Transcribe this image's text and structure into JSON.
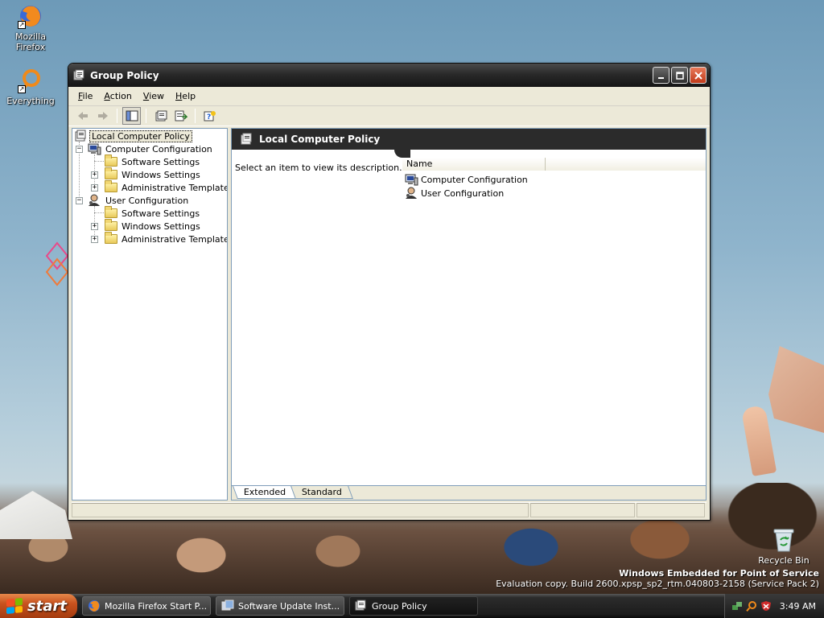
{
  "desktop": {
    "icons": [
      {
        "label": "Mozilla Firefox"
      },
      {
        "label": "Everything"
      }
    ],
    "recycle_bin": {
      "label": "Recycle Bin"
    },
    "watermark": {
      "line1": "Windows Embedded for Point of Service",
      "line2": "Evaluation copy. Build 2600.xpsp_sp2_rtm.040803-2158 (Service Pack 2)"
    }
  },
  "window": {
    "title": "Group Policy",
    "menu": [
      {
        "label": "File",
        "accel": "F",
        "rest": "ile"
      },
      {
        "label": "Action",
        "accel": "A",
        "rest": "ction"
      },
      {
        "label": "View",
        "accel": "V",
        "rest": "iew"
      },
      {
        "label": "Help",
        "accel": "H",
        "rest": "elp"
      }
    ],
    "tree": {
      "root": "Local Computer Policy",
      "computer": {
        "label": "Computer Configuration",
        "children": [
          "Software Settings",
          "Windows Settings",
          "Administrative Templates"
        ]
      },
      "user": {
        "label": "User Configuration",
        "children": [
          "Software Settings",
          "Windows Settings",
          "Administrative Templates"
        ]
      }
    },
    "right_pane": {
      "header_title": "Local Computer Policy",
      "description": "Select an item to view its description.",
      "columns": [
        "Name"
      ],
      "items": [
        "Computer Configuration",
        "User Configuration"
      ],
      "tabs": [
        "Extended",
        "Standard"
      ]
    }
  },
  "taskbar": {
    "start_label": "start",
    "tasks": [
      {
        "label": "Mozilla Firefox Start P..."
      },
      {
        "label": "Software Update Inst..."
      },
      {
        "label": "Group Policy"
      }
    ],
    "clock": "3:49 AM"
  },
  "colors": {
    "title_bar": "#2a2a2a",
    "start_button": "#c8521e",
    "selection": "#ece9d8"
  }
}
